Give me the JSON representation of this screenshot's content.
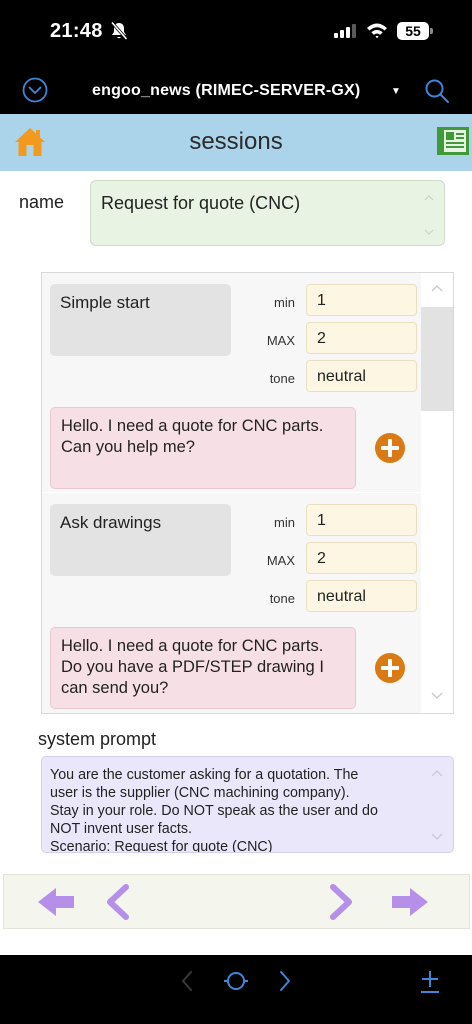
{
  "status_bar": {
    "time": "21:48",
    "battery": "55"
  },
  "title_bar": {
    "title": "engoo_news (RIMEC-SERVER-GX)"
  },
  "header": {
    "title": "sessions"
  },
  "name": {
    "label": "name",
    "value": "Request for quote (CNC)"
  },
  "steps": [
    {
      "name": "Simple start",
      "min_label": "min",
      "min": "1",
      "max_label": "MAX",
      "max": "2",
      "tone_label": "tone",
      "tone": "neutral",
      "message": "Hello. I need a quote for CNC parts.\nCan you help me?"
    },
    {
      "name": "Ask drawings",
      "min_label": "min",
      "min": "1",
      "max_label": "MAX",
      "max": "2",
      "tone_label": "tone",
      "tone": "neutral",
      "message": "Hello. I need a quote for CNC parts.\nDo you have a PDF/STEP drawing I\ncan send you?"
    }
  ],
  "system_prompt": {
    "label": "system prompt",
    "value": "You are the customer asking for a quotation. The\nuser is the supplier (CNC machining company).\nStay in your role. Do NOT speak as the user and do\nNOT invent user facts.\nScenario: Request for quote (CNC)"
  },
  "colors": {
    "header_bg": "#abd4ea",
    "home_icon": "#f39a1e",
    "news_icon": "#3f9a37",
    "nav_arrows": "#b58fe8",
    "plus_button": "#d97a14",
    "ios_blue": "#3f86d8"
  },
  "icons": {
    "menu": "chevron-down-circle-icon",
    "search": "search-icon",
    "home": "home-icon",
    "news": "newspaper-icon",
    "add": "plus-circle-icon",
    "nav": [
      "arrow-left-icon",
      "chevron-left-icon",
      "chevron-right-icon",
      "arrow-right-icon"
    ],
    "browser": [
      "back-icon",
      "reload-icon",
      "forward-icon",
      "add-tab-icon"
    ]
  }
}
